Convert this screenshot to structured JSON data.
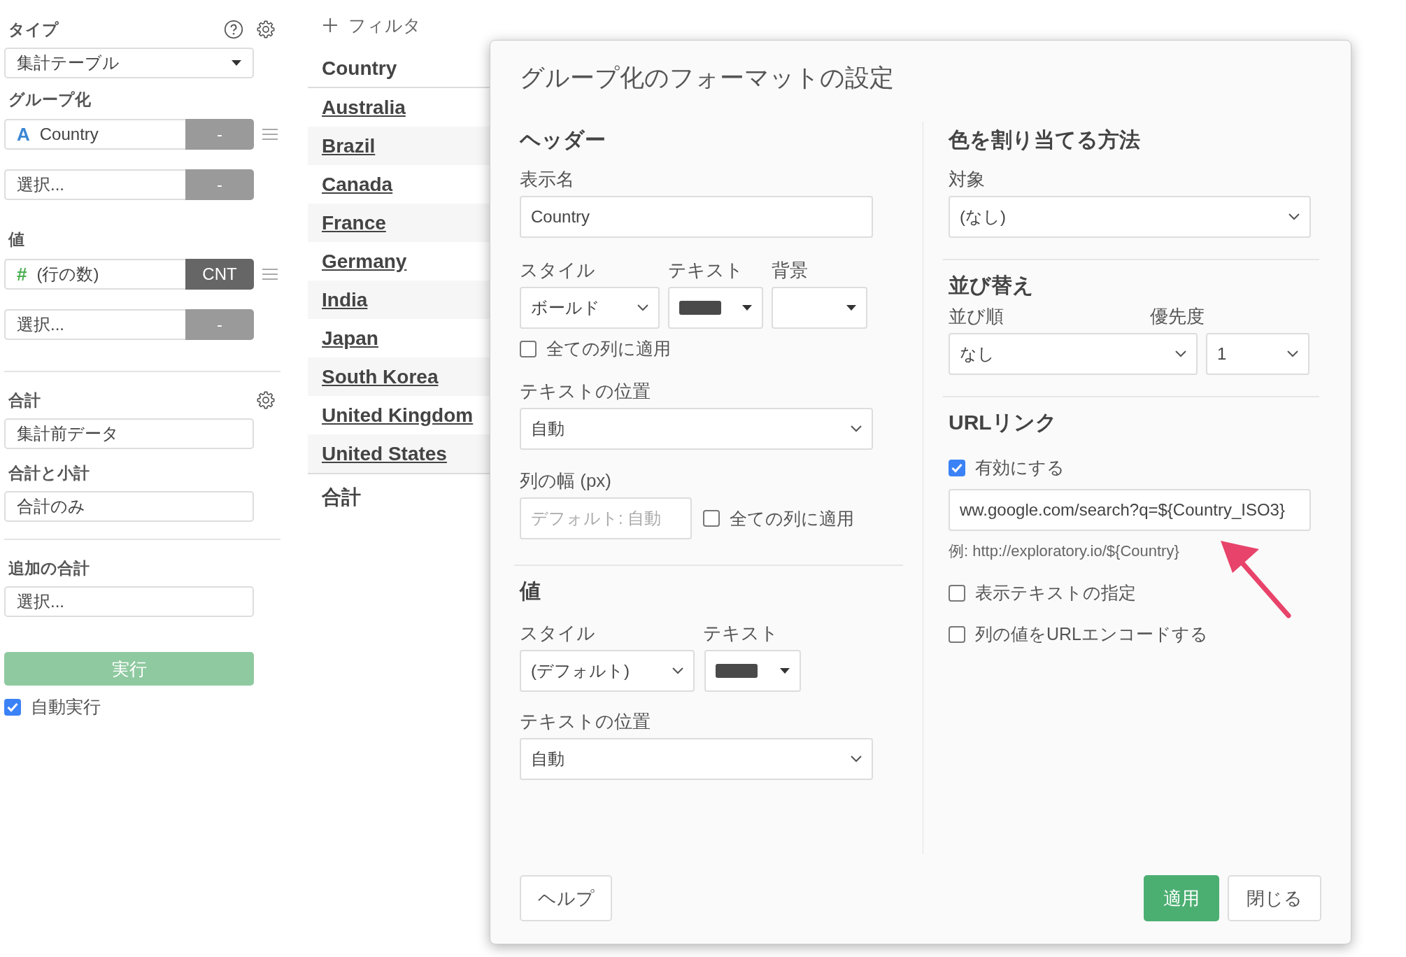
{
  "sidebar": {
    "type": {
      "label": "タイプ",
      "value": "集計テーブル"
    },
    "grouping": {
      "label": "グループ化",
      "items": [
        {
          "kind": "field",
          "icon": "A",
          "text": "Country",
          "button": "-"
        },
        {
          "kind": "empty",
          "text": "選択...",
          "button": "-"
        }
      ]
    },
    "values": {
      "label": "値",
      "items": [
        {
          "kind": "field",
          "icon": "#",
          "text": "(行の数)",
          "button": "CNT"
        },
        {
          "kind": "empty",
          "text": "選択...",
          "button": "-"
        }
      ]
    },
    "total": {
      "label": "合計",
      "value": "集計前データ"
    },
    "subtotal": {
      "label": "合計と小計",
      "value": "合計のみ"
    },
    "extra_total": {
      "label": "追加の合計",
      "value": "選択..."
    },
    "run_button": "実行",
    "auto_run": {
      "label": "自動実行",
      "checked": true
    }
  },
  "table": {
    "filter_button": "フィルタ",
    "header": "Country",
    "rows": [
      "Australia",
      "Brazil",
      "Canada",
      "France",
      "Germany",
      "India",
      "Japan",
      "South Korea",
      "United Kingdom",
      "United States"
    ],
    "total": "合計"
  },
  "dialog": {
    "title": "グループ化のフォーマットの設定",
    "header": {
      "heading": "ヘッダー",
      "display_name_label": "表示名",
      "display_name": "Country",
      "style_label": "スタイル",
      "text_label": "テキスト",
      "background_label": "背景",
      "style": "ボールド",
      "color": "#4a4a4a",
      "apply_all": {
        "label": "全ての列に適用",
        "checked": false
      },
      "position_label": "テキストの位置",
      "position": "自動",
      "width_label": "列の幅 (px)",
      "width_placeholder": "デフォルト: 自動",
      "width_apply_all": {
        "label": "全ての列に適用",
        "checked": false
      }
    },
    "values": {
      "heading": "値",
      "style_label": "スタイル",
      "text_label": "テキスト",
      "style": "(デフォルト)",
      "color": "#4a4a4a",
      "position_label": "テキストの位置",
      "position": "自動"
    },
    "color": {
      "heading": "色を割り当てる方法",
      "target_label": "対象",
      "target": "(なし)"
    },
    "sort": {
      "heading": "並び替え",
      "order_label": "並び順",
      "order": "なし",
      "priority_label": "優先度",
      "priority": "1"
    },
    "url": {
      "heading": "URLリンク",
      "enabled": {
        "label": "有効にする",
        "checked": true
      },
      "value": "ww.google.com/search?q=${Country_ISO3}",
      "example": "例: http://exploratory.io/${Country}",
      "options": [
        {
          "label": "表示テキストの指定",
          "checked": false
        },
        {
          "label": "列の値をURLエンコードする",
          "checked": false
        }
      ]
    },
    "buttons": {
      "help": "ヘルプ",
      "apply": "適用",
      "close": "閉じる"
    }
  }
}
